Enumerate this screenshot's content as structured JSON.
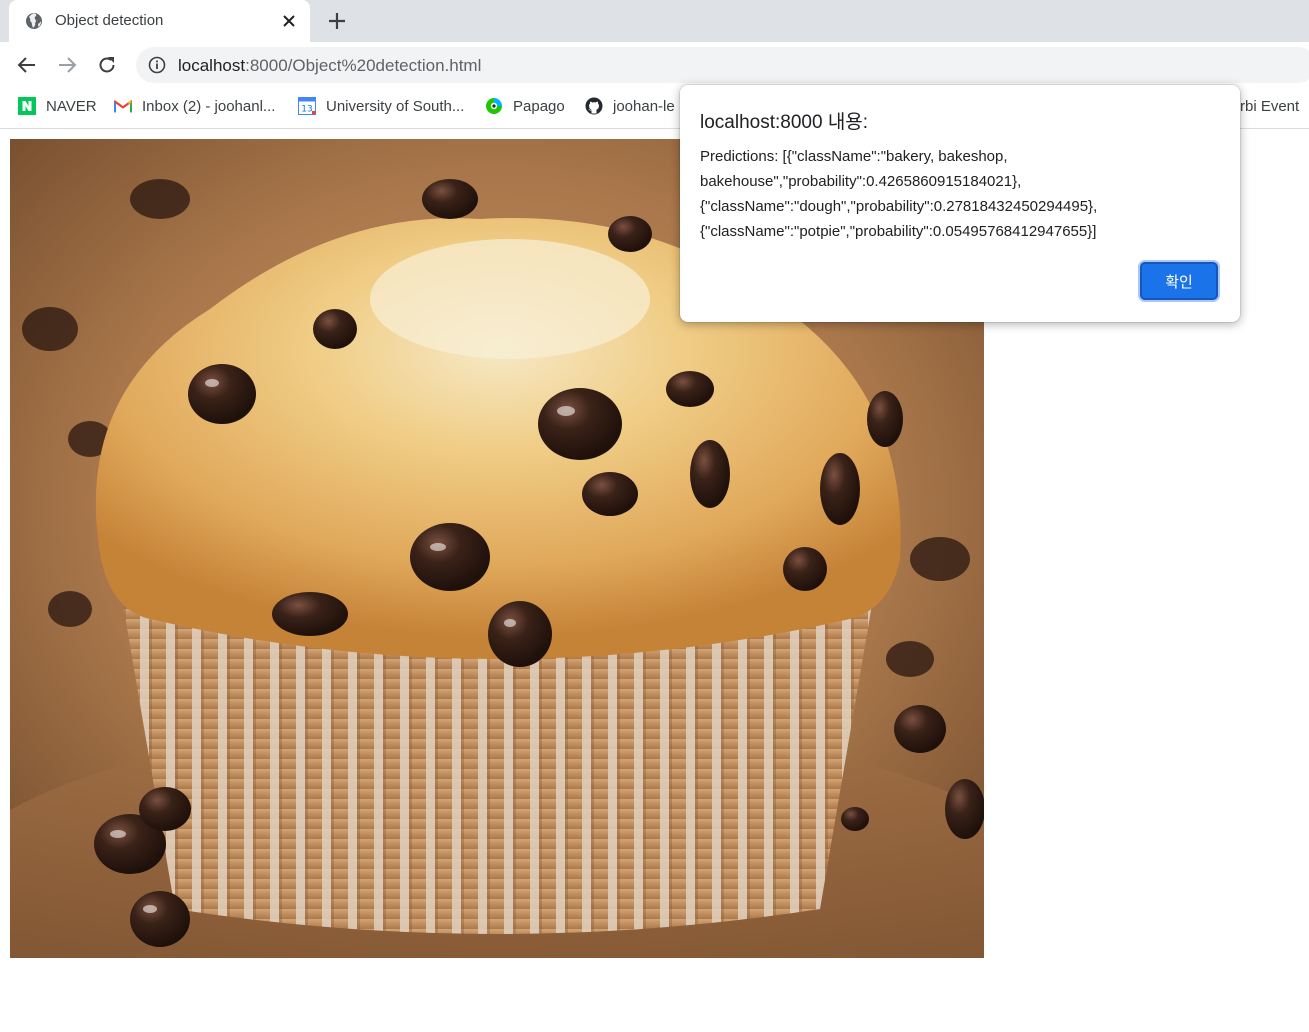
{
  "tab": {
    "title": "Object detection",
    "favicon": "globe-icon"
  },
  "toolbar": {
    "url_host": "localhost",
    "url_path": ":8000/Object%20detection.html"
  },
  "bookmarks": [
    {
      "label": "NAVER",
      "icon": "naver-icon"
    },
    {
      "label": "Inbox (2) - joohanl...",
      "icon": "gmail-icon"
    },
    {
      "label": "University of South...",
      "icon": "calendar-icon"
    },
    {
      "label": "Papago",
      "icon": "papago-icon"
    },
    {
      "label": "joohan-le",
      "icon": "github-icon"
    },
    {
      "label": "rbi Event",
      "icon": ""
    }
  ],
  "dialog": {
    "title": "localhost:8000 내용:",
    "message_lines": [
      "Predictions: [{\"className\":\"bakery, bakeshop,",
      "bakehouse\",\"probability\":0.4265860915184021},",
      "{\"className\":\"dough\",\"probability\":0.27818432450294495},",
      "{\"className\":\"potpie\",\"probability\":0.05495768412947655}]"
    ],
    "ok_label": "확인"
  },
  "colors": {
    "tabstrip": "#dee1e6",
    "omnibox": "#f1f3f4",
    "accent": "#1a73e8",
    "naver_green": "#03c75a"
  }
}
